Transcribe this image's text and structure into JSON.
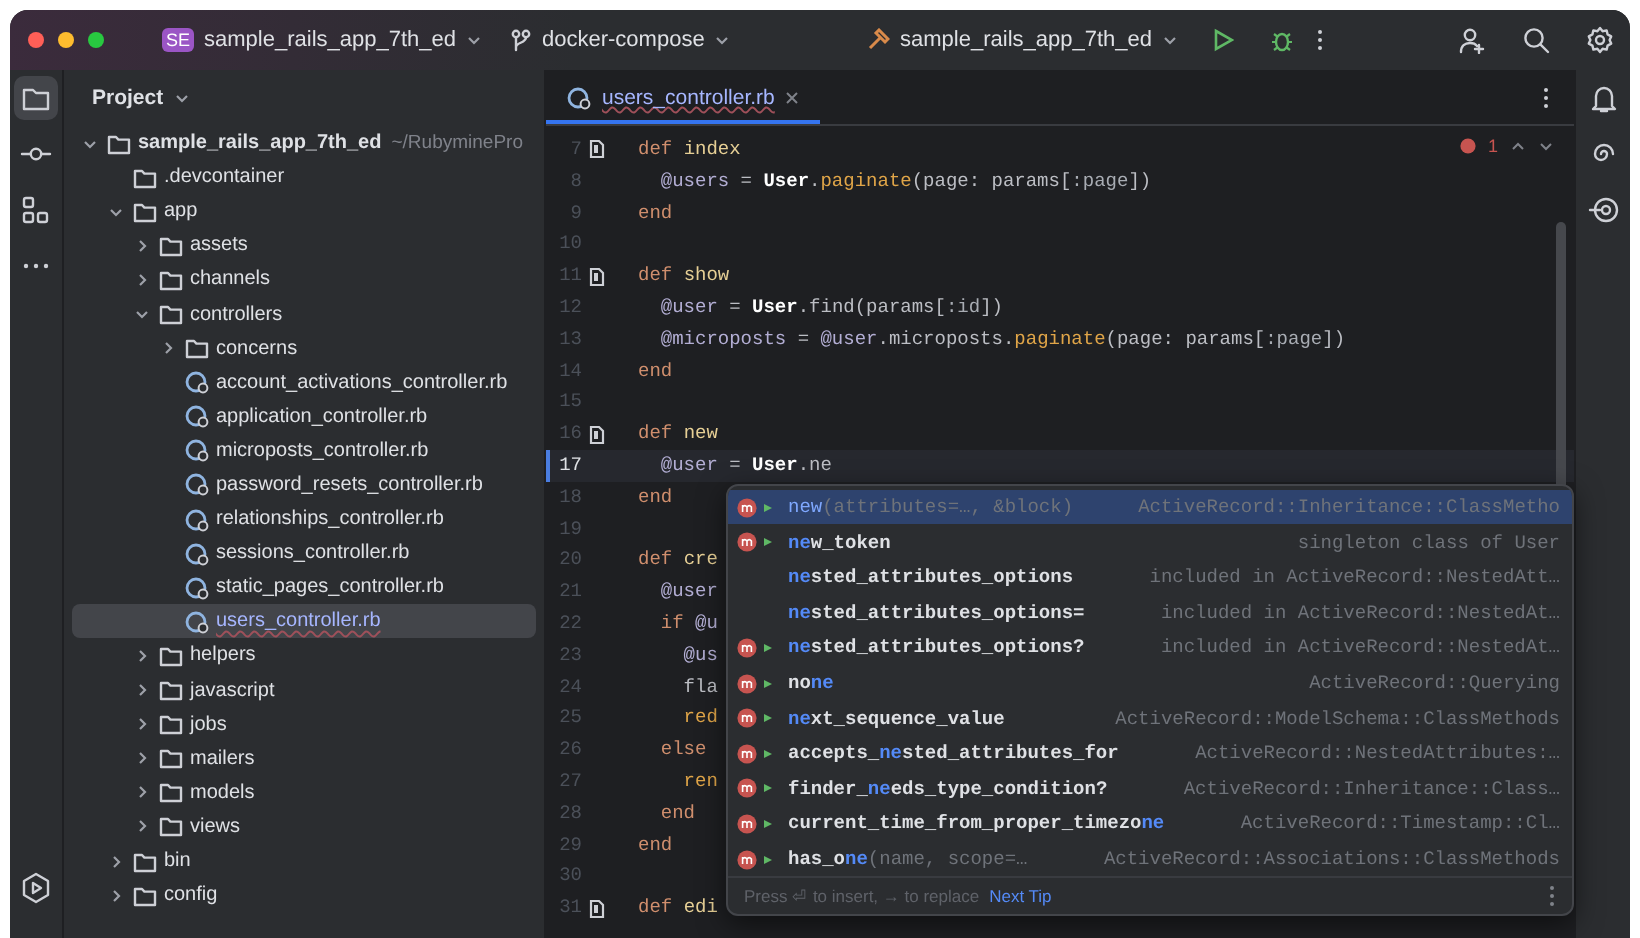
{
  "title_bar": {
    "project_badge": "SE",
    "project": "sample_rails_app_7th_ed",
    "branch": "docker-compose",
    "run_config": "sample_rails_app_7th_ed"
  },
  "left_toolbar": {
    "top": [
      {
        "kind": "folder",
        "selected": true
      },
      {
        "kind": "commit",
        "selected": false
      },
      {
        "kind": "structure",
        "selected": false
      },
      {
        "kind": "more",
        "selected": false
      }
    ],
    "bottom": [
      {
        "kind": "services",
        "selected": false
      }
    ]
  },
  "right_toolbar": [
    {
      "kind": "bell"
    },
    {
      "kind": "spiral"
    },
    {
      "kind": "target"
    }
  ],
  "project_panel": {
    "title": "Project",
    "tree": [
      {
        "label": "sample_rails_app_7th_ed",
        "hint": "~/RubyminePro",
        "kind": "folder",
        "expanded": true,
        "selected": false,
        "children": [
          {
            "label": ".devcontainer",
            "kind": "folder",
            "selected": false
          },
          {
            "label": "app",
            "kind": "folder",
            "expanded": true,
            "selected": false,
            "children": [
              {
                "label": "assets",
                "kind": "folder",
                "expanded": false,
                "selected": false
              },
              {
                "label": "channels",
                "kind": "folder",
                "expanded": false,
                "selected": false
              },
              {
                "label": "controllers",
                "kind": "folder",
                "expanded": true,
                "selected": false,
                "children": [
                  {
                    "label": "concerns",
                    "kind": "folder",
                    "expanded": false,
                    "selected": false
                  },
                  {
                    "label": "account_activations_controller.rb",
                    "kind": "file",
                    "selected": false
                  },
                  {
                    "label": "application_controller.rb",
                    "kind": "file",
                    "selected": false
                  },
                  {
                    "label": "microposts_controller.rb",
                    "kind": "file",
                    "selected": false
                  },
                  {
                    "label": "password_resets_controller.rb",
                    "kind": "file",
                    "selected": false
                  },
                  {
                    "label": "relationships_controller.rb",
                    "kind": "file",
                    "selected": false
                  },
                  {
                    "label": "sessions_controller.rb",
                    "kind": "file",
                    "selected": false
                  },
                  {
                    "label": "static_pages_controller.rb",
                    "kind": "file",
                    "selected": false
                  },
                  {
                    "label": "users_controller.rb",
                    "kind": "file",
                    "selected": true
                  }
                ]
              },
              {
                "label": "helpers",
                "kind": "folder",
                "expanded": false,
                "selected": false
              },
              {
                "label": "javascript",
                "kind": "folder",
                "expanded": false,
                "selected": false
              },
              {
                "label": "jobs",
                "kind": "folder",
                "expanded": false,
                "selected": false
              },
              {
                "label": "mailers",
                "kind": "folder",
                "expanded": false,
                "selected": false
              },
              {
                "label": "models",
                "kind": "folder",
                "expanded": false,
                "selected": false
              },
              {
                "label": "views",
                "kind": "folder",
                "expanded": false,
                "selected": false
              }
            ]
          },
          {
            "label": "bin",
            "kind": "folder",
            "expanded": false,
            "selected": false
          },
          {
            "label": "config",
            "kind": "folder",
            "expanded": false,
            "selected": false
          }
        ]
      }
    ]
  },
  "editor": {
    "tabs": [
      {
        "label": "users_controller.rb",
        "selected": true
      }
    ],
    "problems": "1",
    "lines": [
      {
        "number": "7",
        "marker": true,
        "current": false,
        "tokens": [
          {
            "text": "def ",
            "kind": "keyword"
          },
          {
            "text": "index",
            "kind": "name"
          }
        ]
      },
      {
        "number": "8",
        "marker": false,
        "current": false,
        "tokens": [
          {
            "text": "  @users",
            "kind": "ivar"
          },
          {
            "text": " = ",
            "kind": "plain"
          },
          {
            "text": "User",
            "kind": "const"
          },
          {
            "text": ".",
            "kind": "plain"
          },
          {
            "text": "paginate",
            "kind": "method"
          },
          {
            "text": "(page: params[",
            "kind": "plain"
          },
          {
            "text": ":page",
            "kind": "symbol"
          },
          {
            "text": "])",
            "kind": "plain"
          }
        ]
      },
      {
        "number": "9",
        "marker": false,
        "current": false,
        "tokens": [
          {
            "text": "end",
            "kind": "keyword"
          }
        ]
      },
      {
        "number": "10",
        "marker": false,
        "current": false
      },
      {
        "number": "11",
        "marker": true,
        "current": false,
        "tokens": [
          {
            "text": "def ",
            "kind": "keyword"
          },
          {
            "text": "show",
            "kind": "name"
          }
        ]
      },
      {
        "number": "12",
        "marker": false,
        "current": false,
        "tokens": [
          {
            "text": "  @user",
            "kind": "ivar"
          },
          {
            "text": " = ",
            "kind": "plain"
          },
          {
            "text": "User",
            "kind": "const"
          },
          {
            "text": ".find(params[",
            "kind": "plain"
          },
          {
            "text": ":id",
            "kind": "symbol"
          },
          {
            "text": "])",
            "kind": "plain"
          }
        ]
      },
      {
        "number": "13",
        "marker": false,
        "current": false,
        "tokens": [
          {
            "text": "  @microposts",
            "kind": "ivar"
          },
          {
            "text": " = ",
            "kind": "plain"
          },
          {
            "text": "@user",
            "kind": "ivar"
          },
          {
            "text": ".microposts.",
            "kind": "plain"
          },
          {
            "text": "paginate",
            "kind": "method"
          },
          {
            "text": "(page: params[",
            "kind": "plain"
          },
          {
            "text": ":page",
            "kind": "symbol"
          },
          {
            "text": "])",
            "kind": "plain"
          }
        ]
      },
      {
        "number": "14",
        "marker": false,
        "current": false,
        "tokens": [
          {
            "text": "end",
            "kind": "keyword"
          }
        ]
      },
      {
        "number": "15",
        "marker": false,
        "current": false
      },
      {
        "number": "16",
        "marker": true,
        "current": false,
        "tokens": [
          {
            "text": "def ",
            "kind": "keyword"
          },
          {
            "text": "new",
            "kind": "name"
          }
        ]
      },
      {
        "number": "17",
        "marker": false,
        "current": true,
        "tokens": [
          {
            "text": "  @user",
            "kind": "ivar"
          },
          {
            "text": " = ",
            "kind": "plain"
          },
          {
            "text": "User",
            "kind": "const"
          },
          {
            "text": ".ne",
            "kind": "plain"
          }
        ]
      },
      {
        "number": "18",
        "marker": false,
        "current": false,
        "tokens": [
          {
            "text": "end",
            "kind": "keyword"
          }
        ]
      },
      {
        "number": "19",
        "marker": false,
        "current": false
      },
      {
        "number": "20",
        "marker": false,
        "current": false,
        "tokens": [
          {
            "text": "def ",
            "kind": "keyword"
          },
          {
            "text": "cre",
            "kind": "name"
          }
        ]
      },
      {
        "number": "21",
        "marker": false,
        "current": false,
        "tokens": [
          {
            "text": "  @user",
            "kind": "ivar"
          }
        ]
      },
      {
        "number": "22",
        "marker": false,
        "current": false,
        "tokens": [
          {
            "text": "  if ",
            "kind": "keyword"
          },
          {
            "text": "@u",
            "kind": "ivar"
          }
        ]
      },
      {
        "number": "23",
        "marker": false,
        "current": false,
        "tokens": [
          {
            "text": "    @us",
            "kind": "ivar"
          }
        ]
      },
      {
        "number": "24",
        "marker": false,
        "current": false,
        "tokens": [
          {
            "text": "    fla",
            "kind": "plain"
          }
        ]
      },
      {
        "number": "25",
        "marker": false,
        "current": false,
        "tokens": [
          {
            "text": "    red",
            "kind": "method"
          }
        ]
      },
      {
        "number": "26",
        "marker": false,
        "current": false,
        "tokens": [
          {
            "text": "  else",
            "kind": "keyword"
          }
        ]
      },
      {
        "number": "27",
        "marker": false,
        "current": false,
        "tokens": [
          {
            "text": "    ren",
            "kind": "method"
          }
        ]
      },
      {
        "number": "28",
        "marker": false,
        "current": false,
        "tokens": [
          {
            "text": "  end",
            "kind": "keyword"
          }
        ]
      },
      {
        "number": "29",
        "marker": false,
        "current": false,
        "tokens": [
          {
            "text": "end",
            "kind": "keyword"
          }
        ]
      },
      {
        "number": "30",
        "marker": false,
        "current": false
      },
      {
        "number": "31",
        "marker": true,
        "current": false,
        "tokens": [
          {
            "text": "def ",
            "kind": "keyword"
          },
          {
            "text": "edi",
            "kind": "name"
          }
        ]
      }
    ],
    "completion": {
      "items": [
        {
          "has_icon": true,
          "selected": true,
          "match": "new",
          "params": "(attributes=…, &block)",
          "type": "ActiveRecord::Inheritance::ClassMetho"
        },
        {
          "has_icon": true,
          "selected": false,
          "match": "ne",
          "after": "w_token",
          "type": "singleton class of User"
        },
        {
          "has_icon": false,
          "selected": false,
          "match": "ne",
          "after": "sted_attributes_options",
          "type": "included in ActiveRecord::NestedAtt…"
        },
        {
          "has_icon": false,
          "selected": false,
          "match": "ne",
          "after": "sted_attributes_options=",
          "type": "included in ActiveRecord::NestedAt…"
        },
        {
          "has_icon": true,
          "selected": false,
          "match": "ne",
          "after": "sted_attributes_options?",
          "type": "included in ActiveRecord::NestedAt…"
        },
        {
          "has_icon": true,
          "selected": false,
          "before": "no",
          "match": "ne",
          "type": "ActiveRecord::Querying"
        },
        {
          "has_icon": true,
          "selected": false,
          "match": "ne",
          "after": "xt_sequence_value",
          "type": "ActiveRecord::ModelSchema::ClassMethods"
        },
        {
          "has_icon": true,
          "selected": false,
          "before": "accepts_",
          "match": "ne",
          "after": "sted_attributes_for",
          "type": "ActiveRecord::NestedAttributes:…"
        },
        {
          "has_icon": true,
          "selected": false,
          "before": "finder_",
          "match": "ne",
          "after": "eds_type_condition?",
          "type": "ActiveRecord::Inheritance::Class…"
        },
        {
          "has_icon": true,
          "selected": false,
          "before": "current_time_from_proper_timezo",
          "match": "ne",
          "type": "ActiveRecord::Timestamp::Cl…"
        },
        {
          "has_icon": true,
          "selected": false,
          "before": "has_o",
          "match": "ne",
          "params": "(name, scope=…",
          "type": "ActiveRecord::Associations::ClassMethods"
        }
      ],
      "footer": "Press ⏎ to insert, → to replace",
      "tip_link": "Next Tip"
    }
  }
}
